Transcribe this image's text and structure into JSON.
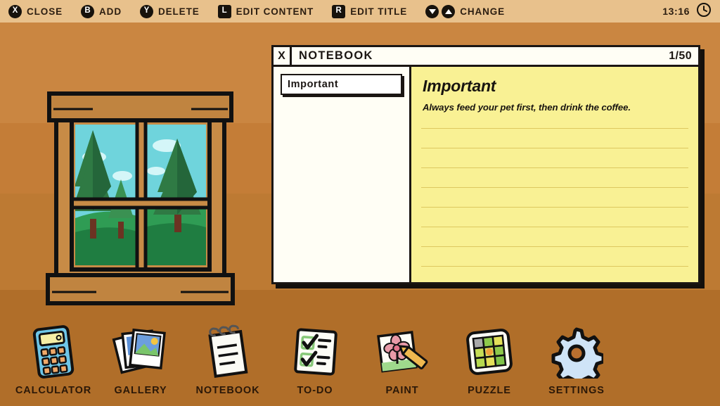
{
  "topbar": {
    "hints": [
      {
        "badge": "X",
        "badge_shape": "round",
        "label": "CLOSE",
        "icon": "button-x-icon"
      },
      {
        "badge": "B",
        "badge_shape": "round",
        "label": "ADD",
        "icon": "button-b-icon"
      },
      {
        "badge": "Y",
        "badge_shape": "round",
        "label": "DELETE",
        "icon": "button-y-icon"
      },
      {
        "badge": "L",
        "badge_shape": "square",
        "label": "EDIT CONTENT",
        "icon": "button-l-icon"
      },
      {
        "badge": "R",
        "badge_shape": "square",
        "label": "EDIT TITLE",
        "icon": "button-r-icon"
      }
    ],
    "change_hint": {
      "label": "CHANGE",
      "icons": [
        "dpad-down-icon",
        "dpad-up-icon"
      ]
    },
    "clock": "13:16",
    "clock_icon": "clock-icon",
    "background_color": "#e8c18c",
    "text_color": "#2b1d10"
  },
  "wall": {
    "band_colors": [
      "#ca8641",
      "#c47d37",
      "#bd7a33",
      "#b06e29"
    ]
  },
  "window_art": {
    "name": "window-illustration",
    "sky_color": "#6fd4dc",
    "cloud_color": "#c8f2f5",
    "tree_color": "#2f7a44",
    "tree_dark_color": "#1e5c33",
    "grass_color": "#2f9c54",
    "frame_color": "#c78b46",
    "sill_color": "#c08440"
  },
  "notebook": {
    "close_label": "X",
    "title": "NOTEBOOK",
    "page_counter": "1/50",
    "notes": [
      {
        "title": "Important",
        "selected": true
      }
    ],
    "open_note": {
      "heading": "Important",
      "body": "Always feed your pet first, then drink the coffee."
    },
    "paper_color": "#f9f194",
    "rule_color": "#ddc860",
    "border_color": "#1b1613",
    "rule_count": 9
  },
  "dock": {
    "items": [
      {
        "label": "CALCULATOR",
        "icon": "calculator-icon"
      },
      {
        "label": "GALLERY",
        "icon": "gallery-icon"
      },
      {
        "label": "NOTEBOOK",
        "icon": "notebook-icon"
      },
      {
        "label": "TO-DO",
        "icon": "todo-icon"
      },
      {
        "label": "PAINT",
        "icon": "paint-icon"
      },
      {
        "label": "PUZZLE",
        "icon": "puzzle-icon"
      },
      {
        "label": "SETTINGS",
        "icon": "settings-gear-icon"
      }
    ],
    "label_color": "#2b1808"
  }
}
